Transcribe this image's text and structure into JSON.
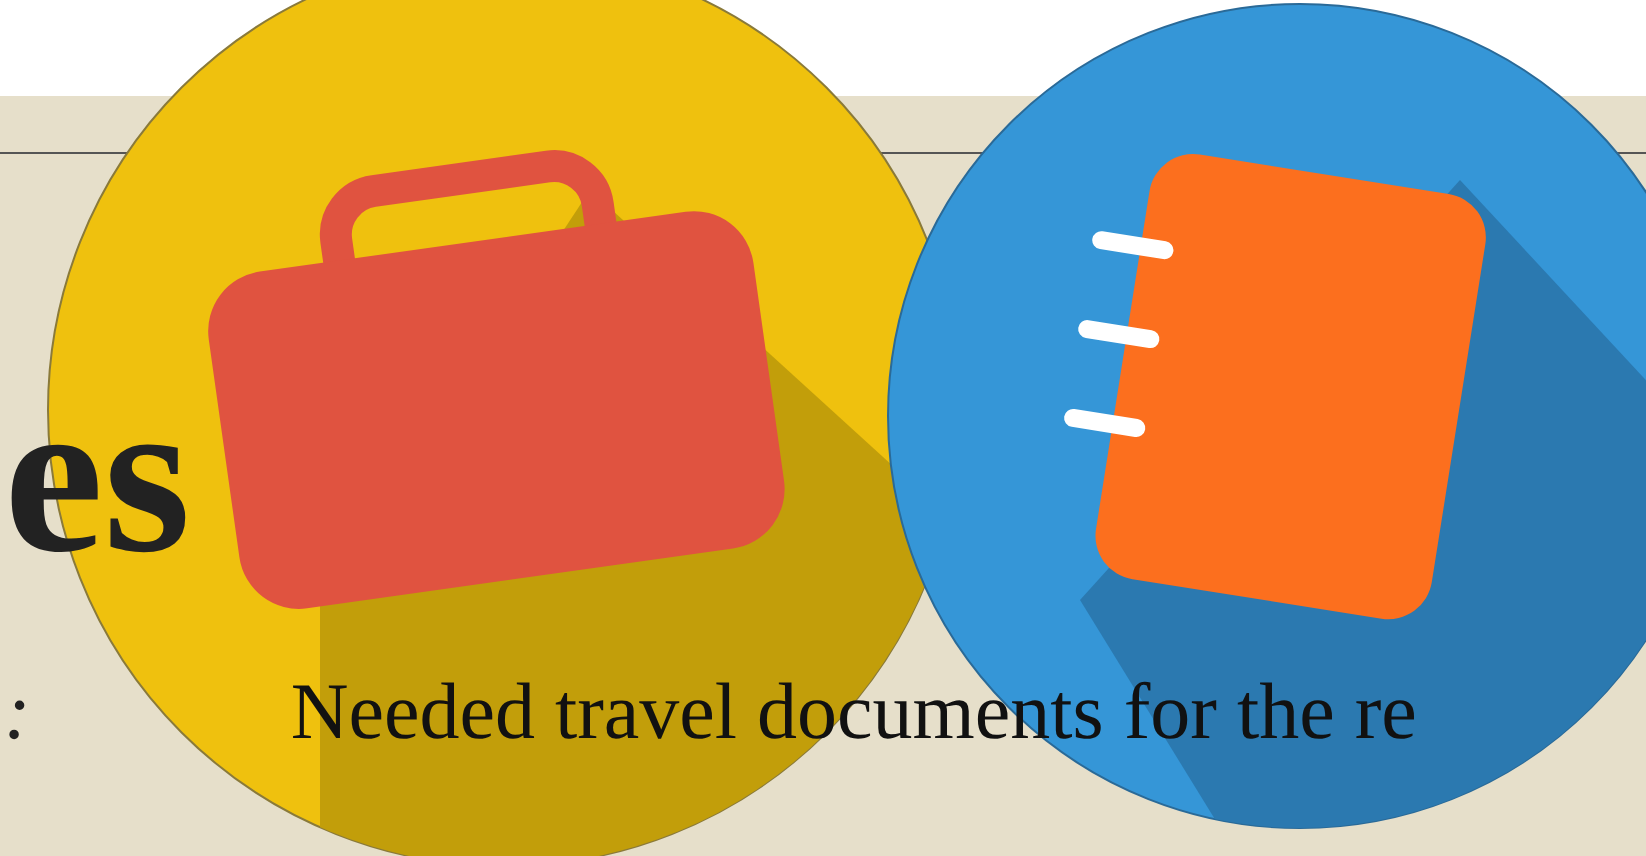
{
  "heading": "es",
  "side_text": ":",
  "body": "Needed travel documents for the re"
}
